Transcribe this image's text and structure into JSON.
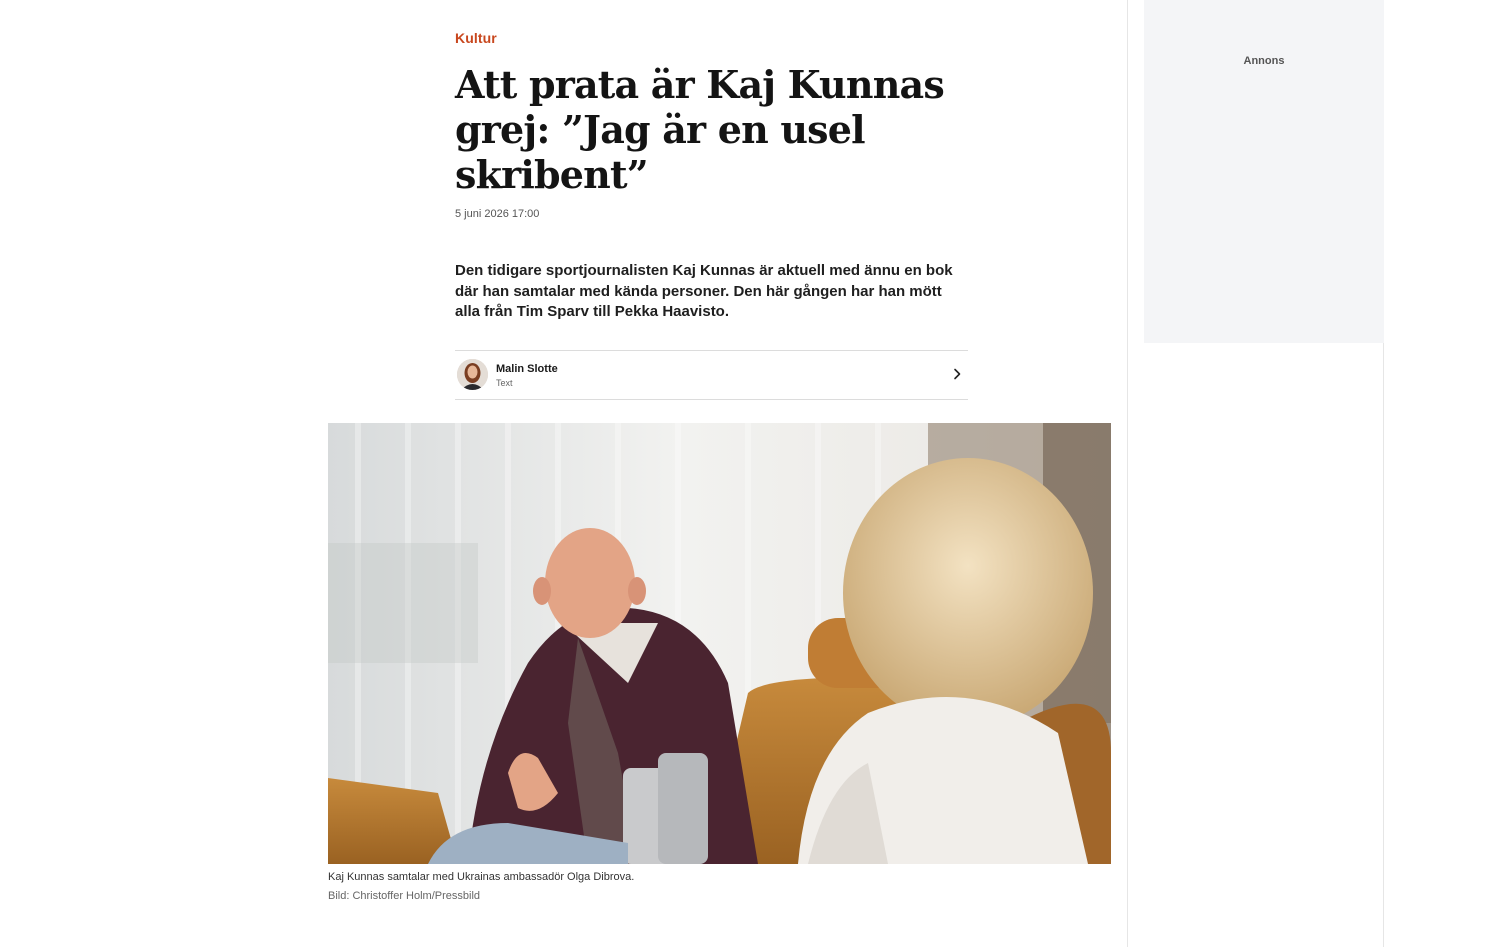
{
  "article": {
    "section": "Kultur",
    "headline": "Att prata är Kaj Kunnas grej: ”Jag är en usel skribent”",
    "published": "5 juni 2026 17:00",
    "lead": "Den tidigare sportjournalisten Kaj Kunnas är aktuell med ännu en bok där han samtalar med kända personer. Den här gången har han mött alla från Tim Sparv till Pekka Haavisto.",
    "author": {
      "name": "Malin Slotte",
      "role": "Text"
    },
    "image": {
      "caption": "Kaj Kunnas samtalar med Ukrainas ambassadör Olga Dibrova.",
      "credit": "Bild: Christoffer Holm/Pressbild"
    }
  },
  "ad": {
    "label": "Annons"
  },
  "colors": {
    "section": "#c8471e",
    "ad_background": "#f4f5f7",
    "divider": "#dcdcdc"
  },
  "icons": {
    "byline_arrow": "chevron-right-icon"
  }
}
